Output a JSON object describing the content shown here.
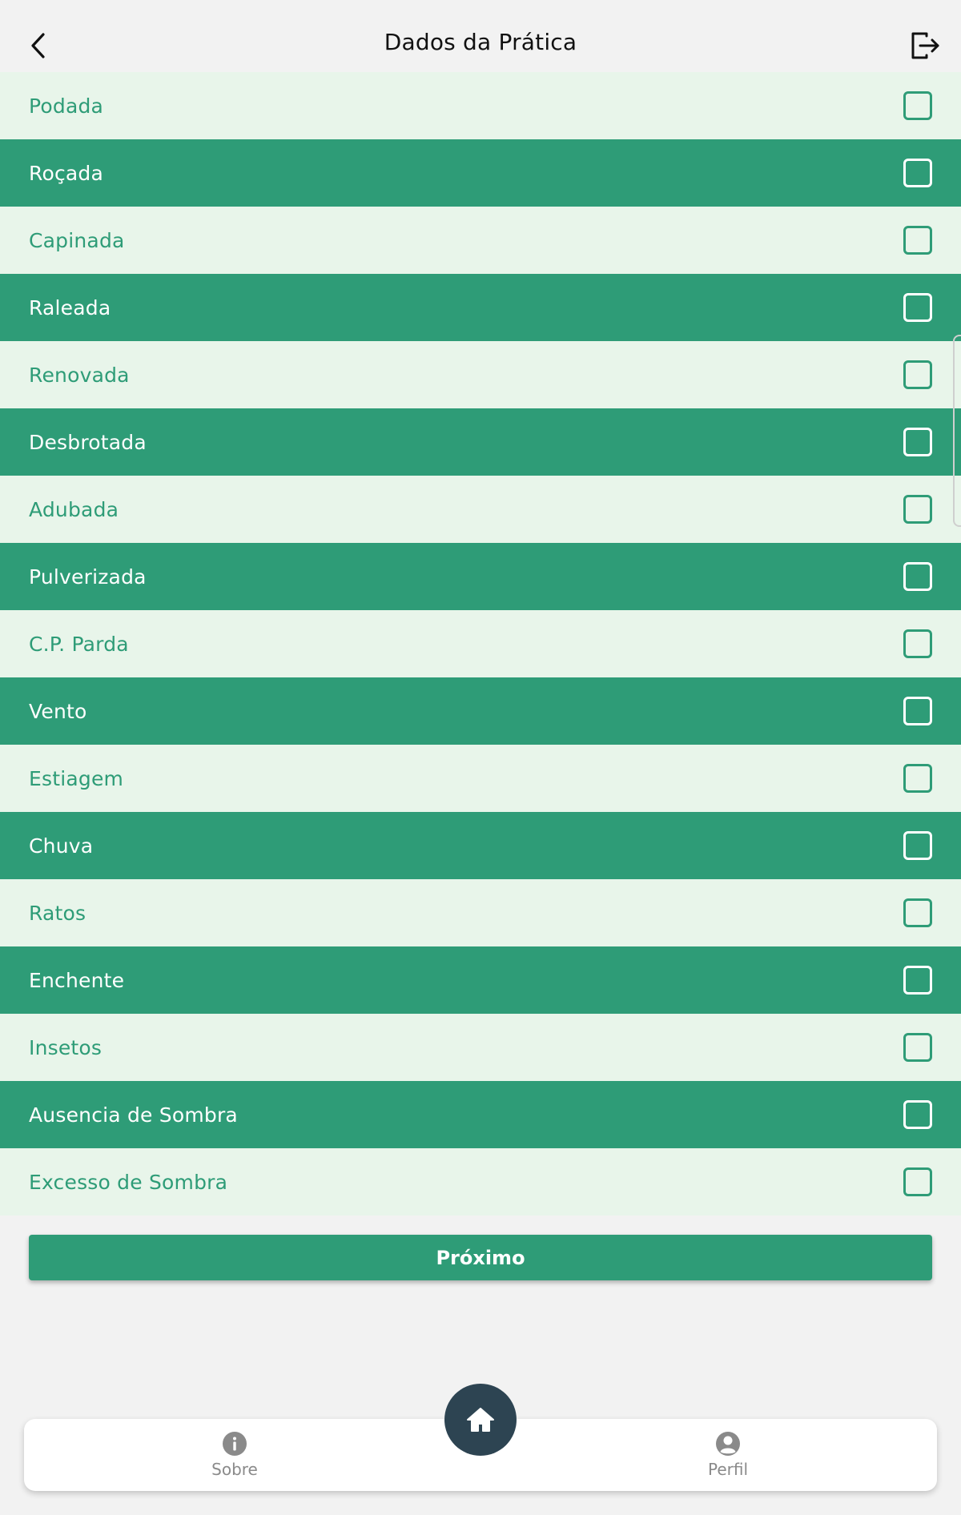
{
  "header": {
    "title": "Dados da Prática"
  },
  "items": [
    {
      "label": "Podada",
      "checked": false
    },
    {
      "label": "Roçada",
      "checked": false
    },
    {
      "label": "Capinada",
      "checked": false
    },
    {
      "label": "Raleada",
      "checked": false
    },
    {
      "label": "Renovada",
      "checked": false
    },
    {
      "label": "Desbrotada",
      "checked": false
    },
    {
      "label": "Adubada",
      "checked": false
    },
    {
      "label": "Pulverizada",
      "checked": false
    },
    {
      "label": "C.P. Parda",
      "checked": false
    },
    {
      "label": "Vento",
      "checked": false
    },
    {
      "label": "Estiagem",
      "checked": false
    },
    {
      "label": "Chuva",
      "checked": false
    },
    {
      "label": "Ratos",
      "checked": false
    },
    {
      "label": "Enchente",
      "checked": false
    },
    {
      "label": "Insetos",
      "checked": false
    },
    {
      "label": "Ausencia de Sombra",
      "checked": false
    },
    {
      "label": "Excesso de Sombra",
      "checked": false
    }
  ],
  "next_button": {
    "label": "Próximo"
  },
  "bottom_nav": {
    "sobre_label": "Sobre",
    "perfil_label": "Perfil"
  },
  "colors": {
    "accent": "#2e9c77",
    "row_light": "#e8f5ea",
    "home_button": "#2d4452"
  },
  "icons": {
    "back": "chevron-left-icon",
    "logout": "logout-icon",
    "home": "home-icon",
    "sobre": "info-icon",
    "perfil": "user-icon"
  }
}
